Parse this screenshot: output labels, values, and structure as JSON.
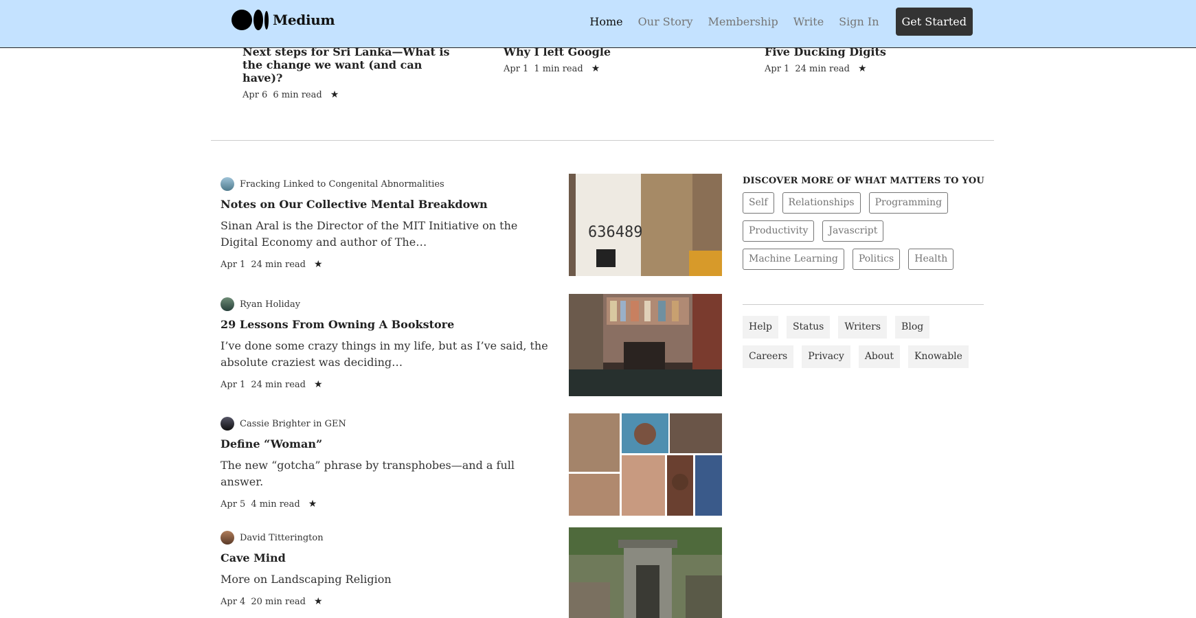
{
  "header": {
    "brand": "Medium",
    "nav": [
      "Home",
      "Our Story",
      "Membership",
      "Write",
      "Sign In"
    ],
    "cta": "Get Started"
  },
  "top_posts": [
    {
      "title": "Next steps for Sri Lanka—What is the change we want (and can have)?",
      "date": "Apr 6",
      "read": "6 min read"
    },
    {
      "title": "Why I left Google",
      "date": "Apr 1",
      "read": "1 min read"
    },
    {
      "title": "Five Ducking Digits",
      "date": "Apr 1",
      "read": "24 min read"
    }
  ],
  "posts": [
    {
      "author": "Fracking Linked to Congenital Abnormalities",
      "title": "Notes on Our Collective Mental Breakdown",
      "subtitle": "Sinan Aral is the Director of the MIT Initiative on the Digital Economy and author of The…",
      "date": "Apr 1",
      "read": "24 min read"
    },
    {
      "author": "Ryan Holiday",
      "title": "29 Lessons From Owning A Bookstore",
      "subtitle": "I’ve done some crazy things in my life, but as I’ve said, the absolute craziest was deciding…",
      "date": "Apr 1",
      "read": "24 min read"
    },
    {
      "author": "Cassie Brighter in GEN",
      "title": "Define “Woman”",
      "subtitle": "The new “gotcha” phrase by transphobes—and a full answer.",
      "date": "Apr 5",
      "read": "4 min read"
    },
    {
      "author": "David Titterington",
      "title": "Cave Mind",
      "subtitle": "More on Landscaping Religion",
      "date": "Apr 4",
      "read": "20 min read"
    }
  ],
  "sidebar": {
    "heading": "DISCOVER MORE OF WHAT MATTERS TO YOU",
    "tags": [
      "Self",
      "Relationships",
      "Programming",
      "Productivity",
      "Javascript",
      "Machine Learning",
      "Politics",
      "Health"
    ],
    "links": [
      "Help",
      "Status",
      "Writers",
      "Blog",
      "Careers",
      "Privacy",
      "About",
      "Knowable"
    ]
  },
  "icons": {
    "star": "star-icon",
    "logo": "medium-logo-icon"
  },
  "colors": {
    "header_bg": "#c4e2ff",
    "cta_bg": "#333333"
  }
}
